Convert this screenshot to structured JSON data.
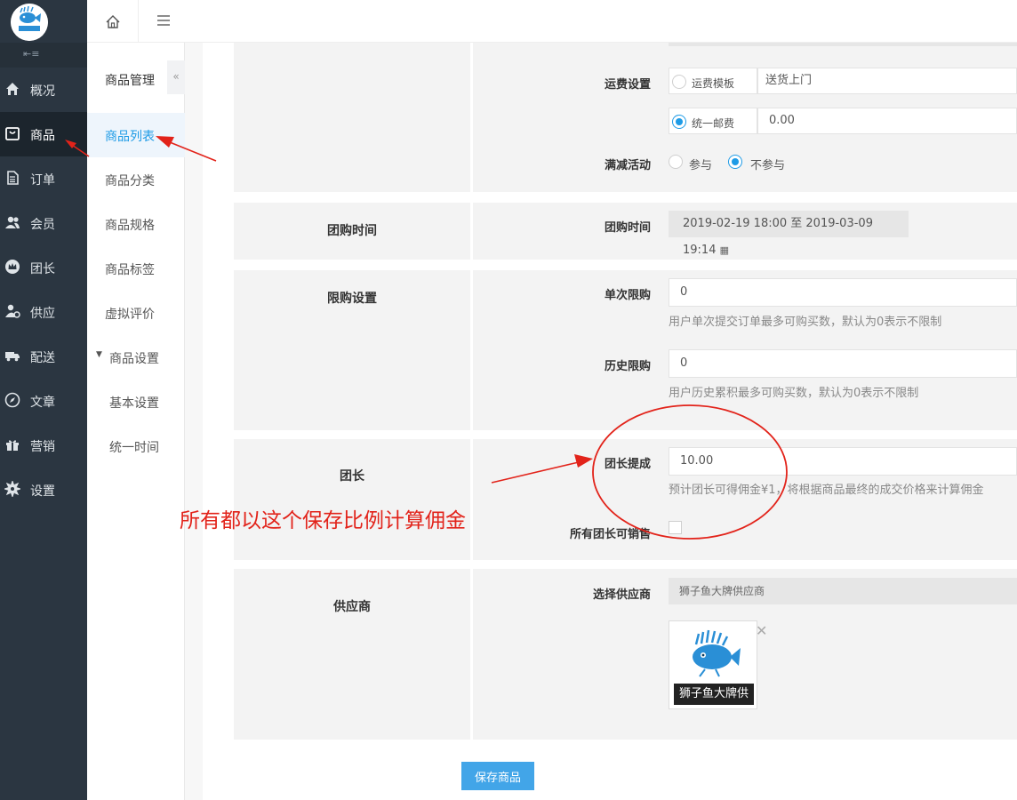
{
  "nav": {
    "items": [
      {
        "label": "概况",
        "icon": "home-icon"
      },
      {
        "label": "商品",
        "icon": "bag-icon"
      },
      {
        "label": "订单",
        "icon": "document-icon"
      },
      {
        "label": "会员",
        "icon": "users-icon"
      },
      {
        "label": "团长",
        "icon": "crown-icon"
      },
      {
        "label": "供应",
        "icon": "supplier-icon"
      },
      {
        "label": "配送",
        "icon": "truck-icon"
      },
      {
        "label": "文章",
        "icon": "compass-icon"
      },
      {
        "label": "营销",
        "icon": "gift-icon"
      },
      {
        "label": "设置",
        "icon": "gear-icon"
      }
    ],
    "logo_text": "狮子鱼"
  },
  "subnav": {
    "title": "商品管理",
    "items": [
      "商品列表",
      "商品分类",
      "商品规格",
      "商品标签",
      "虚拟评价"
    ],
    "group_label": "商品设置",
    "group_items": [
      "基本设置",
      "统一时间"
    ]
  },
  "form": {
    "shipping": {
      "label": "运费设置",
      "option_template": "运费模板",
      "template_value": "送货上门",
      "option_flat": "统一邮费",
      "flat_value": "0.00"
    },
    "discount": {
      "label": "满减活动",
      "option_join": "参与",
      "option_no": "不参与"
    },
    "group_time": {
      "section": "团购时间",
      "label": "团购时间",
      "value": "2019-02-19 18:00 至 2019-03-09 19:14"
    },
    "limit": {
      "section": "限购设置",
      "single_label": "单次限购",
      "single_value": "0",
      "single_help": "用户单次提交订单最多可购买数，默认为0表示不限制",
      "history_label": "历史限购",
      "history_value": "0",
      "history_help": "用户历史累积最多可购买数，默认为0表示不限制"
    },
    "leader": {
      "section": "团长",
      "commission_label": "团长提成",
      "commission_value": "10.00",
      "commission_help": "预计团长可得佣金¥1，将根据商品最终的成交价格来计算佣金",
      "all_can_sell_label": "所有团长可销售"
    },
    "supplier": {
      "section": "供应商",
      "label": "选择供应商",
      "value": "狮子鱼大牌供应商",
      "thumb_caption": "狮子鱼大牌供"
    },
    "save_label": "保存商品"
  },
  "annotation": {
    "text": "所有都以这个保存比例计算佣金",
    "color": "#e2231a"
  },
  "colors": {
    "accent": "#1e9be6",
    "nav_bg": "#2b3641",
    "button": "#42a5e8"
  }
}
